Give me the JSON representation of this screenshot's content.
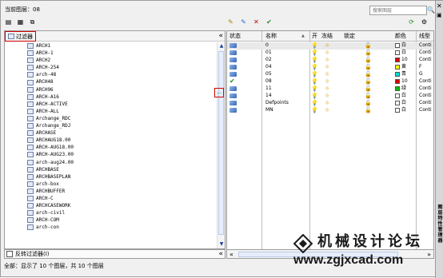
{
  "header": {
    "current_layer_label": "当前图层：",
    "current_layer": "08"
  },
  "search": {
    "placeholder": "搜索图层"
  },
  "filter_tree": {
    "root_label": "过滤器",
    "items": [
      "ARCH1",
      "ARCH-1",
      "ARCH2",
      "ARCH-254",
      "arch-48",
      "ARCH48",
      "ARCH96",
      "ARCH-A16",
      "ARCH-ACTIVE",
      "ARCH-ALL",
      "Archange_RDC",
      "Archange_RDJ",
      "ARCHASE",
      "ARCHAUG18.00",
      "ARCH-AUG18.00",
      "ARCH-AUG23.00",
      "arch-aug24.00",
      "ARCHBASE",
      "ARCHBASEPLAN",
      "arch-box",
      "ARCHBUFFER",
      "ARCH-C",
      "ARCHCASEWORK",
      "arch-civil",
      "ARCH-COM",
      "arch-con"
    ]
  },
  "invert_filter": {
    "label": "反转过滤器(I)",
    "checked": false
  },
  "columns": {
    "status": "状态",
    "name": "名称",
    "on": "开",
    "freeze": "冻结",
    "lock": "锁定",
    "color": "颜色",
    "linetype": "线型"
  },
  "layers": [
    {
      "name": "0",
      "color_name": "白",
      "color_num": "",
      "swatch": "#ffffff",
      "current": false,
      "linetype": "Conti"
    },
    {
      "name": "01",
      "color_name": "白",
      "color_num": "",
      "swatch": "#ffffff",
      "current": false,
      "linetype": "Conti"
    },
    {
      "name": "02",
      "color_name": "",
      "color_num": "10",
      "swatch": "#d40000",
      "current": false,
      "linetype": "Conti"
    },
    {
      "name": "04",
      "color_name": "黄",
      "color_num": "",
      "swatch": "#ffff00",
      "current": false,
      "linetype": "F"
    },
    {
      "name": "05",
      "color_name": "青",
      "color_num": "",
      "swatch": "#00d8d8",
      "current": false,
      "linetype": "G"
    },
    {
      "name": "08",
      "color_name": "",
      "color_num": "10",
      "swatch": "#d40000",
      "current": true,
      "linetype": "Conti"
    },
    {
      "name": "11",
      "color_name": "绿",
      "color_num": "",
      "swatch": "#00c000",
      "current": false,
      "linetype": "Conti"
    },
    {
      "name": "14",
      "color_name": "白",
      "color_num": "",
      "swatch": "#ffffff",
      "current": false,
      "linetype": "Conti"
    },
    {
      "name": "Defpoints",
      "color_name": "白",
      "color_num": "",
      "swatch": "#ffffff",
      "current": false,
      "linetype": "Conti"
    },
    {
      "name": "MN",
      "color_name": "白",
      "color_num": "",
      "swatch": "#ffffff",
      "current": false,
      "linetype": "Conti"
    }
  ],
  "status_bar": "全部：显示了 10 个图层，共 10 个图层",
  "side_title": "图层特性管理器",
  "watermark": {
    "text": "机械设计论坛",
    "url": "www.zgjxcad.com"
  },
  "icons": {
    "current_layer": "check-icon",
    "layer_state": "layer-state-icon",
    "on": "lightbulb-icon",
    "freeze": "sun-icon",
    "lock": "padlock-open-icon"
  }
}
